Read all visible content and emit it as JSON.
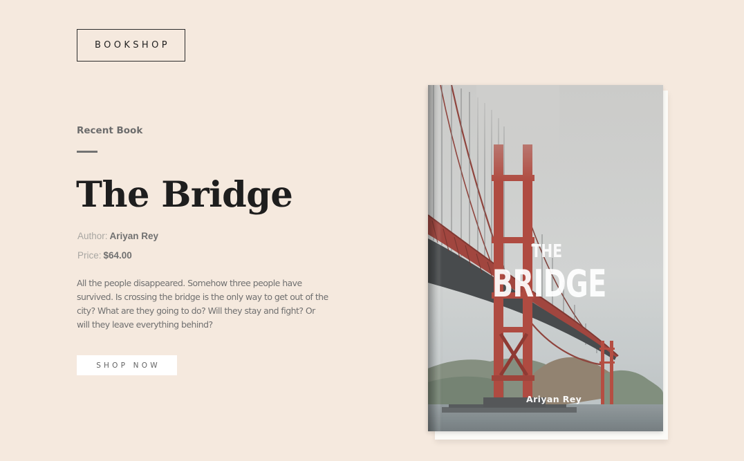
{
  "brand": {
    "logo_text": "BOOKSHOP"
  },
  "hero": {
    "eyebrow": "Recent Book",
    "title": "The Bridge",
    "author_label": "Author:",
    "author_value": "Ariyan Rey",
    "price_label": "Price:",
    "price_value": "$64.00",
    "description": "All the people disappeared. Somehow three people have survived. Is crossing the bridge is the only way to get out of the city? What are they going to do? Will they stay and fight? Or will they leave everything behind?",
    "cta_label": "SHOP NOW"
  },
  "book_cover": {
    "the": "THE",
    "title": "BRIDGE",
    "author": "Ariyan Rey"
  },
  "colors": {
    "background": "#f5e9de",
    "text_dark": "#1e1e1e",
    "text_body": "#707070",
    "text_muted": "#a8a6a2",
    "eyebrow": "#6c6c6c",
    "eyebrow_rule": "#737373",
    "button_bg": "#ffffff",
    "button_text": "#646464",
    "bridge_red": "#b2433a"
  }
}
